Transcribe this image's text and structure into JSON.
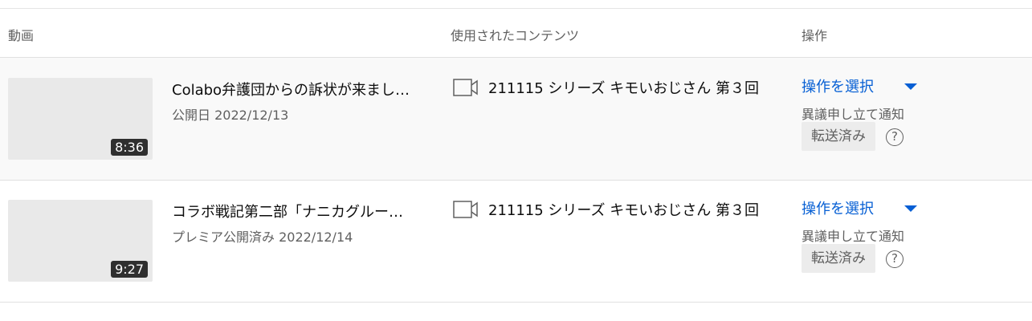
{
  "table": {
    "headers": {
      "video": "動画",
      "content_used": "使用されたコンテンツ",
      "actions": "操作"
    },
    "rows": [
      {
        "title": "Colabo弁護団からの訴状が来まし…",
        "date": "公開日 2022/12/13",
        "duration": "8:36",
        "content": "211115 シリーズ キモいおじさん 第３回",
        "action_label": "操作を選択",
        "notice": "異議申し立て通知",
        "status": "転送済み",
        "help": "?"
      },
      {
        "title": "コラボ戦記第二部「ナニカグルー…",
        "date": "プレミア公開済み 2022/12/14",
        "duration": "9:27",
        "content": "211115 シリーズ キモいおじさん 第３回",
        "action_label": "操作を選択",
        "notice": "異議申し立て通知",
        "status": "転送済み",
        "help": "?"
      }
    ]
  },
  "icons": {
    "content_icon": "video-camera-outline-icon",
    "dropdown_icon": "caret-down-icon",
    "help_icon": "question-circle-icon"
  },
  "colors": {
    "link_blue": "#065fd4",
    "secondary_text": "#606060",
    "row_highlight": "#f9f9f9"
  }
}
